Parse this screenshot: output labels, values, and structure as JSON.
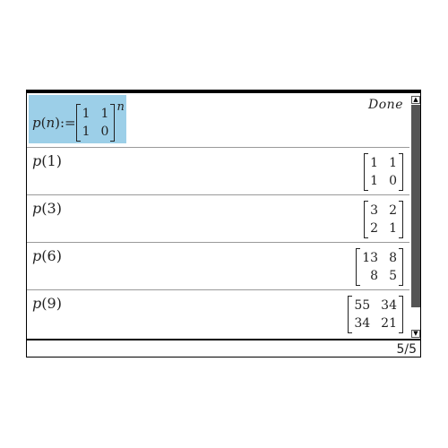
{
  "definition": {
    "fn": "p",
    "arg": "n",
    "assign": ":=",
    "matrix": [
      [
        "1",
        "1"
      ],
      [
        "1",
        "0"
      ]
    ],
    "exponent": "n",
    "result": "Done"
  },
  "rows": [
    {
      "fn": "p",
      "arg": "1",
      "matrix": [
        [
          "1",
          "1"
        ],
        [
          "1",
          "0"
        ]
      ]
    },
    {
      "fn": "p",
      "arg": "3",
      "matrix": [
        [
          "3",
          "2"
        ],
        [
          "2",
          "1"
        ]
      ]
    },
    {
      "fn": "p",
      "arg": "6",
      "matrix": [
        [
          "13",
          "8"
        ],
        [
          "8",
          "5"
        ]
      ]
    },
    {
      "fn": "p",
      "arg": "9",
      "matrix": [
        [
          "55",
          "34"
        ],
        [
          "34",
          "21"
        ]
      ]
    }
  ],
  "status": {
    "page_indicator": "5/5"
  },
  "scrollbar": {
    "position_fraction": 1.0
  },
  "colors": {
    "selection": "#9ccfe8",
    "thumb": "#555555"
  }
}
